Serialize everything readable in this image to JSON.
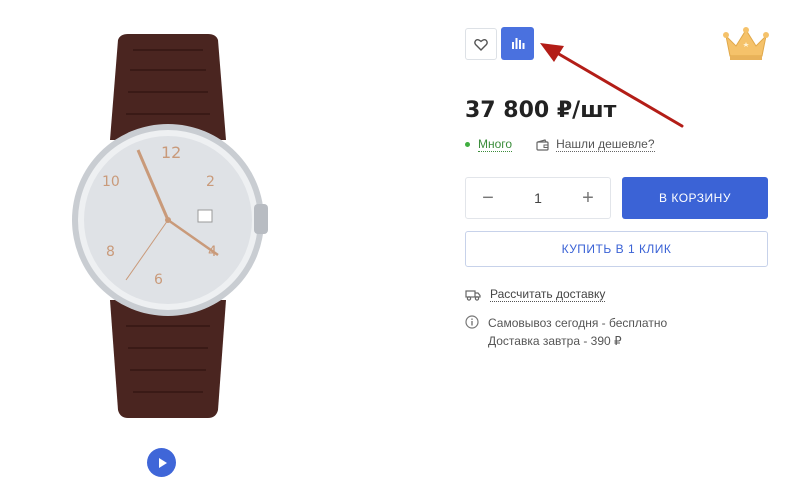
{
  "price": "37 800 ₽/шт",
  "stock": {
    "label": "Много"
  },
  "cheaper_link": "Нашли дешевле?",
  "quantity": {
    "value": "1",
    "minus": "−",
    "plus": "+"
  },
  "cart_button": "В КОРЗИНУ",
  "one_click_button": "КУПИТЬ В 1 КЛИК",
  "delivery_link": "Рассчитать доставку",
  "pickup": {
    "line1": "Самовывоз сегодня - бесплатно",
    "line2": "Доставка завтра - 390 ₽"
  },
  "colors": {
    "accent": "#3b63d6",
    "compare_active": "#4a71df",
    "in_stock": "#3fae3f",
    "annotation_arrow": "#b31d17"
  },
  "icons": {
    "favorite": "heart-icon",
    "compare": "bar-chart-icon",
    "video": "play-icon",
    "cheaper": "wallet-icon",
    "delivery": "truck-icon",
    "info": "info-icon",
    "badge": "crown-icon"
  }
}
